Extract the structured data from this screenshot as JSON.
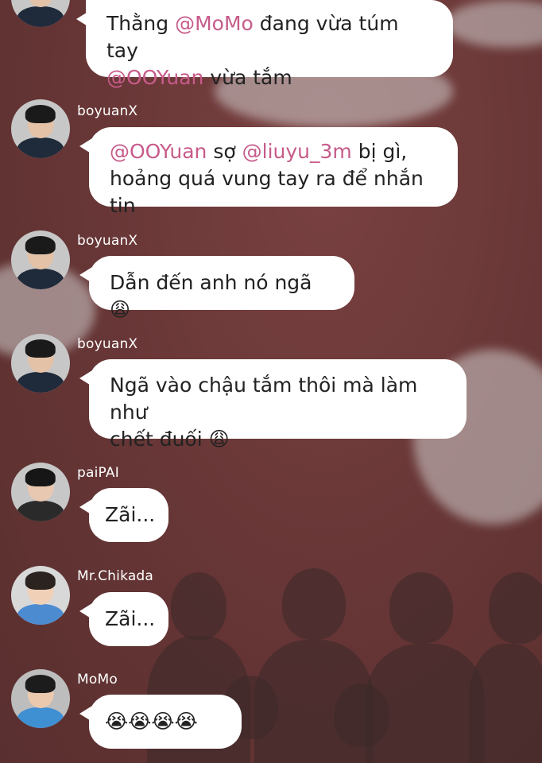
{
  "messages": [
    {
      "id": "m1",
      "sender": "",
      "parts": [
        {
          "type": "text",
          "text": "Thằng "
        },
        {
          "type": "mention",
          "text": "@MoMo"
        },
        {
          "type": "text",
          "text": " đang vừa túm tay"
        },
        {
          "type": "break"
        },
        {
          "type": "mention",
          "text": "@OOYuan"
        },
        {
          "type": "text",
          "text": " vừa tắm"
        }
      ]
    },
    {
      "id": "m2",
      "sender": "boyuanX",
      "parts": [
        {
          "type": "mention",
          "text": "@OOYuan"
        },
        {
          "type": "text",
          "text": " sợ "
        },
        {
          "type": "mention",
          "text": "@liuyu_3m"
        },
        {
          "type": "text",
          "text": " bị gì,"
        },
        {
          "type": "break"
        },
        {
          "type": "text",
          "text": "hoảng quá vung tay ra để nhắn tin"
        }
      ]
    },
    {
      "id": "m3",
      "sender": "boyuanX",
      "parts": [
        {
          "type": "text",
          "text": "Dẫn đến anh nó ngã 😩"
        }
      ]
    },
    {
      "id": "m4",
      "sender": "boyuanX",
      "parts": [
        {
          "type": "text",
          "text": "Ngã vào chậu tắm thôi mà làm như"
        },
        {
          "type": "break"
        },
        {
          "type": "text",
          "text": "chết đuối 😩"
        }
      ]
    },
    {
      "id": "m5",
      "sender": "paiPAI",
      "parts": [
        {
          "type": "text",
          "text": "Zãi..."
        }
      ]
    },
    {
      "id": "m6",
      "sender": "Mr.Chikada",
      "parts": [
        {
          "type": "text",
          "text": "Zãi..."
        }
      ]
    },
    {
      "id": "m7",
      "sender": "MoMo",
      "parts": [
        {
          "type": "text",
          "text": "😭😭😭😭"
        }
      ]
    }
  ],
  "colors": {
    "mention": "#c75b8a",
    "bubble": "#ffffff",
    "name_text": "#ffffff",
    "background": "#6f3a3a"
  },
  "icons": {
    "avatar": "person-avatar-icon",
    "tired_face": "tired-face-emoji",
    "crying_face": "crying-face-emoji",
    "sweat_drop": "sweat-drop-emoji"
  }
}
